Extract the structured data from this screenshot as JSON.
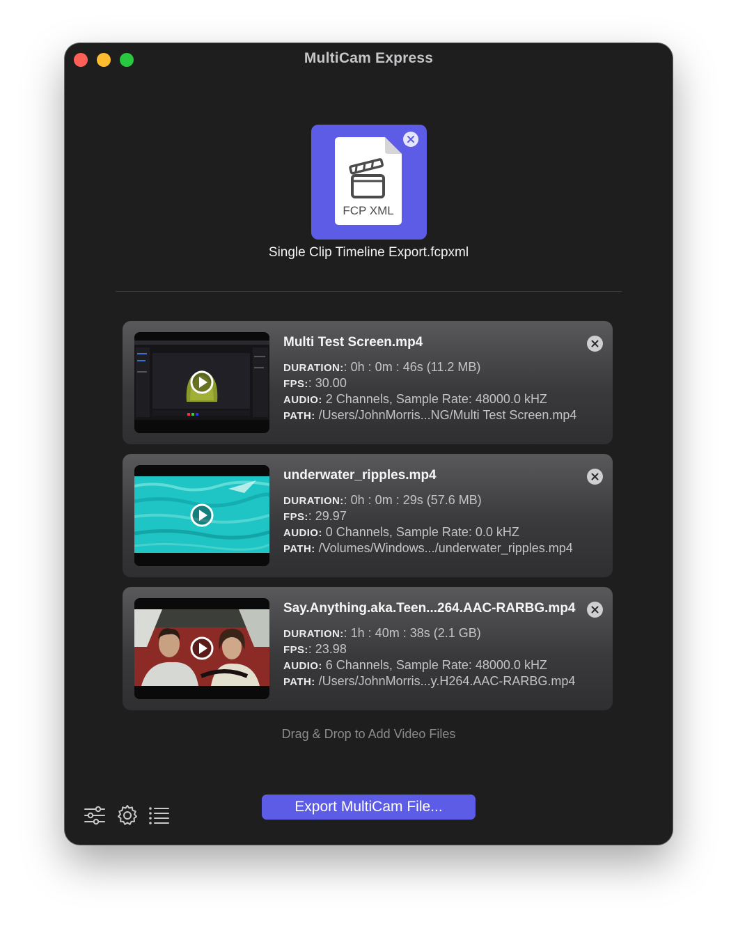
{
  "window": {
    "title": "MultiCam Express"
  },
  "xml_file": {
    "icon": "fcp-xml-document-icon",
    "icon_label": "FCP XML",
    "name": "Single Clip Timeline Export.fcpxml",
    "tile_color": "#5d5ce6"
  },
  "labels": {
    "duration": "DURATION:",
    "fps": "FPS:",
    "audio": "AUDIO:",
    "path": "PATH:"
  },
  "clips": [
    {
      "name": "Multi Test Screen.mp4",
      "duration": ": 0h : 0m : 46s (11.2 MB)",
      "fps": ": 30.00",
      "audio": "2 Channels, Sample Rate: 48000.0 kHZ",
      "path": "/Users/JohnMorris...NG/Multi Test Screen.mp4"
    },
    {
      "name": "underwater_ripples.mp4",
      "duration": ": 0h : 0m : 29s (57.6 MB)",
      "fps": ": 29.97",
      "audio": "0 Channels, Sample Rate: 0.0 kHZ",
      "path": "/Volumes/Windows.../underwater_ripples.mp4"
    },
    {
      "name": "Say.Anything.aka.Teen...264.AAC-RARBG.mp4",
      "duration": ": 1h : 40m : 38s (2.1 GB)",
      "fps": ": 23.98",
      "audio": "6 Channels, Sample Rate: 48000.0 kHZ",
      "path": "/Users/JohnMorris...y.H264.AAC-RARBG.mp4"
    }
  ],
  "drop_hint": "Drag & Drop to Add Video Files",
  "toolbar": {
    "icons": [
      "sliders-icon",
      "gear-icon",
      "list-icon"
    ],
    "export_label": "Export MultiCam File...",
    "accent": "#5d5ce6"
  }
}
